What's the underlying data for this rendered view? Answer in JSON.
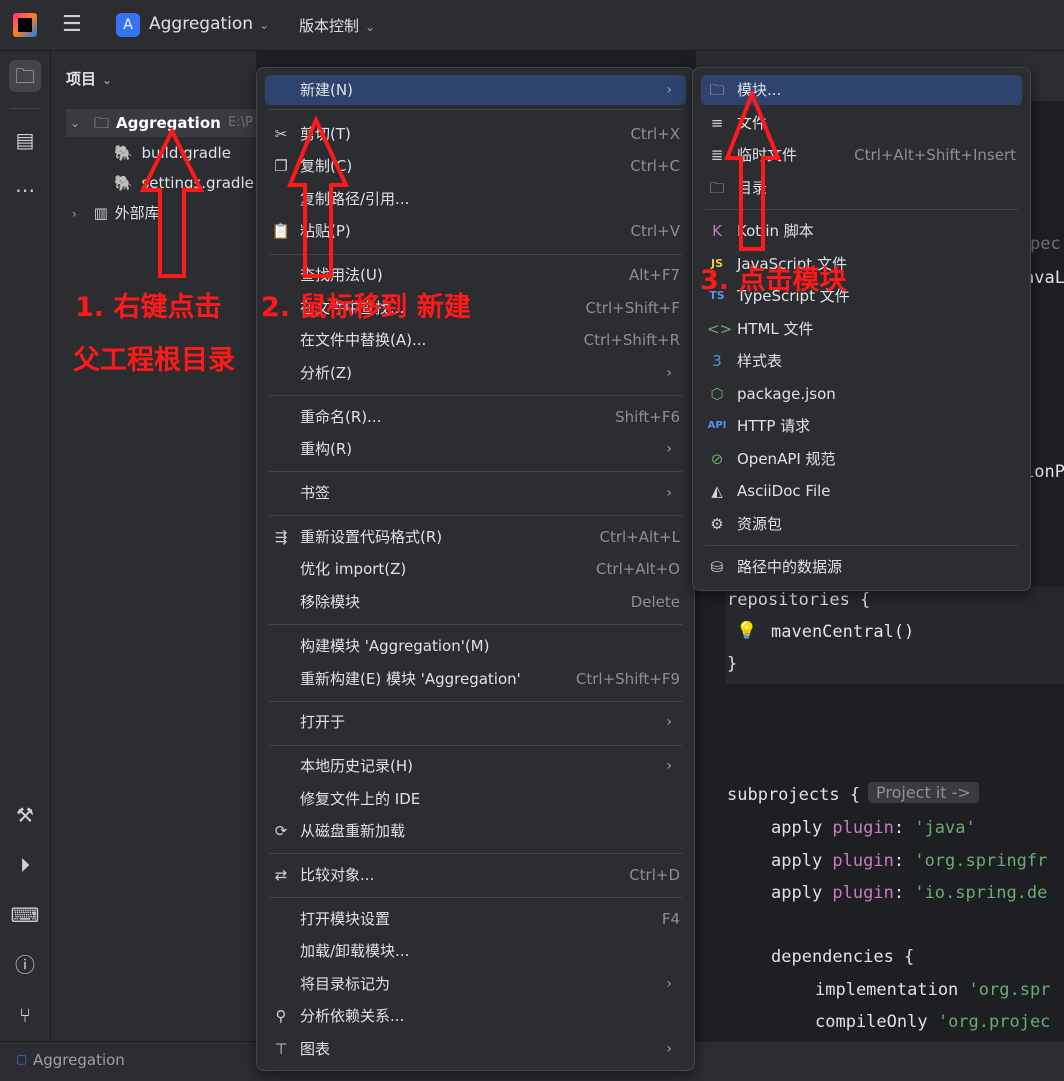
{
  "titlebar": {
    "project_name": "Aggregation",
    "project_badge": "A",
    "vcs_label": "版本控制"
  },
  "project_panel": {
    "title": "项目",
    "root": {
      "name": "Aggregation",
      "path": "E:\\P"
    },
    "files": [
      "build.gradle",
      "settings.gradle"
    ],
    "external": "外部库"
  },
  "context_menu": {
    "new": "新建(N)",
    "cut": {
      "label": "剪切(T)",
      "shortcut": "Ctrl+X"
    },
    "copy": {
      "label": "复制(C)",
      "shortcut": "Ctrl+C"
    },
    "copy_path": "复制路径/引用...",
    "paste": {
      "label": "粘贴(P)",
      "shortcut": "Ctrl+V"
    },
    "find_usages": {
      "label": "查找用法(U)",
      "shortcut": "Alt+F7"
    },
    "find_in_files": {
      "label": "在文件中查找...",
      "shortcut": "Ctrl+Shift+F"
    },
    "replace_in_files": {
      "label": "在文件中替换(A)...",
      "shortcut": "Ctrl+Shift+R"
    },
    "analyze": "分析(Z)",
    "rename": {
      "label": "重命名(R)...",
      "shortcut": "Shift+F6"
    },
    "refactor": "重构(R)",
    "bookmarks": "书签",
    "reformat": {
      "label": "重新设置代码格式(R)",
      "shortcut": "Ctrl+Alt+L"
    },
    "optimize_imports": {
      "label": "优化 import(Z)",
      "shortcut": "Ctrl+Alt+O"
    },
    "remove_module": {
      "label": "移除模块",
      "shortcut": "Delete"
    },
    "build_module": "构建模块 'Aggregation'(M)",
    "rebuild_module": {
      "label": "重新构建(E) 模块 'Aggregation'",
      "shortcut": "Ctrl+Shift+F9"
    },
    "open_in": "打开于",
    "local_history": "本地历史记录(H)",
    "repair_ide": "修复文件上的 IDE",
    "reload_from_disk": "从磁盘重新加载",
    "compare_with": {
      "label": "比较对象...",
      "shortcut": "Ctrl+D"
    },
    "module_settings": {
      "label": "打开模块设置",
      "shortcut": "F4"
    },
    "load_unload": "加载/卸载模块...",
    "mark_directory": "将目录标记为",
    "analyze_deps": "分析依赖关系...",
    "diagrams": "图表"
  },
  "submenu": {
    "module": "模块...",
    "file": "文件",
    "scratch": {
      "label": "临时文件",
      "shortcut": "Ctrl+Alt+Shift+Insert"
    },
    "directory": "目录",
    "kotlin_script": "Kotlin 脚本",
    "javascript": "JavaScript 文件",
    "typescript": "TypeScript 文件",
    "html": "HTML 文件",
    "stylesheet": "样式表",
    "package_json": "package.json",
    "http_request": "HTTP 请求",
    "openapi": "OpenAPI 规范",
    "asciidoc": "AsciiDoc File",
    "resource_bundle": "资源包",
    "data_source": "路径中的数据源"
  },
  "editor": {
    "repositories": "repositories {",
    "maven_central": "mavenCentral()",
    "close_brace": "}",
    "subprojects": "subprojects {",
    "inlay_hint": "Project it ->",
    "apply1_str": "'java'",
    "apply2_str": "'org.springfr",
    "apply3_str": "'io.spring.de",
    "dependencies": "dependencies {",
    "impl_str": "'org.spr",
    "compile_str": "'org.projec",
    "frag1": "pec",
    "frag2": "avaL",
    "frag3": "ionP"
  },
  "annotations": {
    "step1_line1": "1. 右键点击",
    "step1_line2": "父工程根目录",
    "step2": "2. 鼠标移到 新建",
    "step3": "3. 点击模块"
  },
  "statusbar": {
    "project": "Aggregation"
  }
}
